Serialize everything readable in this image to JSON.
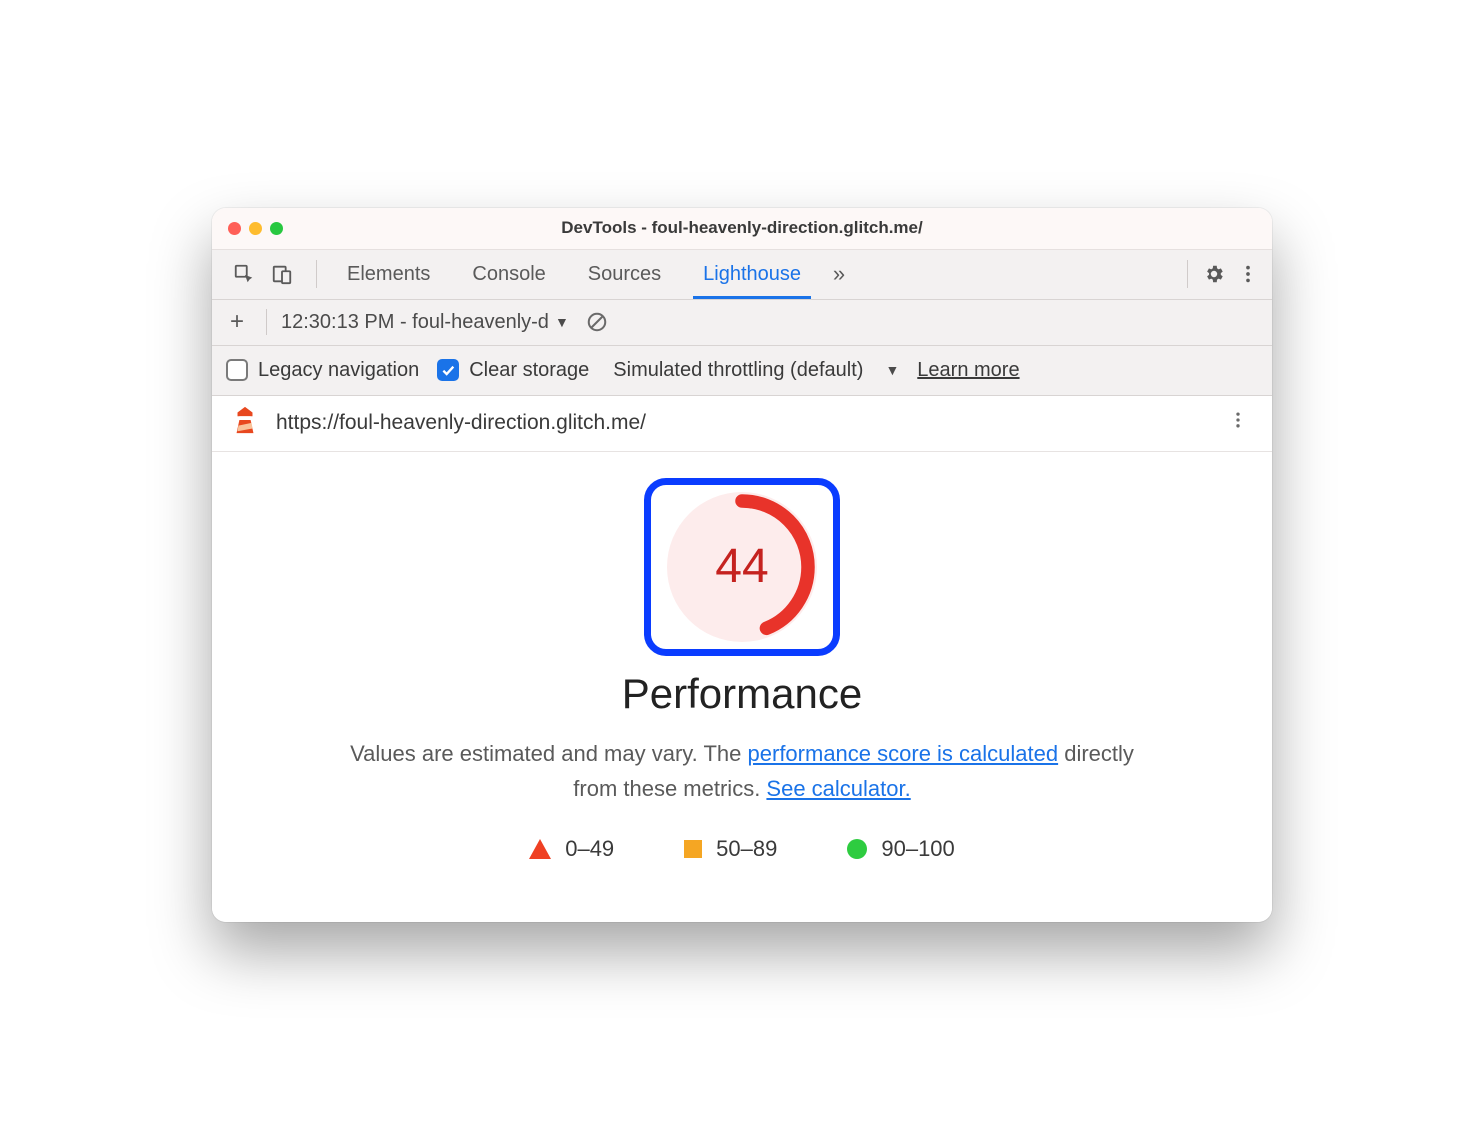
{
  "window": {
    "title": "DevTools - foul-heavenly-direction.glitch.me/"
  },
  "tabs": {
    "items": [
      "Elements",
      "Console",
      "Sources",
      "Lighthouse"
    ],
    "active_index": 3
  },
  "subbar": {
    "report_label": "12:30:13 PM - foul-heavenly-d"
  },
  "options": {
    "legacy_label": "Legacy navigation",
    "legacy_checked": false,
    "clear_label": "Clear storage",
    "clear_checked": true,
    "throttle_label": "Simulated throttling (default)",
    "learn_more": "Learn more"
  },
  "urlbar": {
    "url": "https://foul-heavenly-direction.glitch.me/"
  },
  "report": {
    "score": "44",
    "score_percent": 44,
    "heading": "Performance",
    "desc_pre": "Values are estimated and may vary. The ",
    "link1": "performance score is calculated",
    "desc_mid": " directly from these metrics. ",
    "link2": "See calculator.",
    "legend": {
      "r1": "0–49",
      "r2": "50–89",
      "r3": "90–100"
    }
  }
}
